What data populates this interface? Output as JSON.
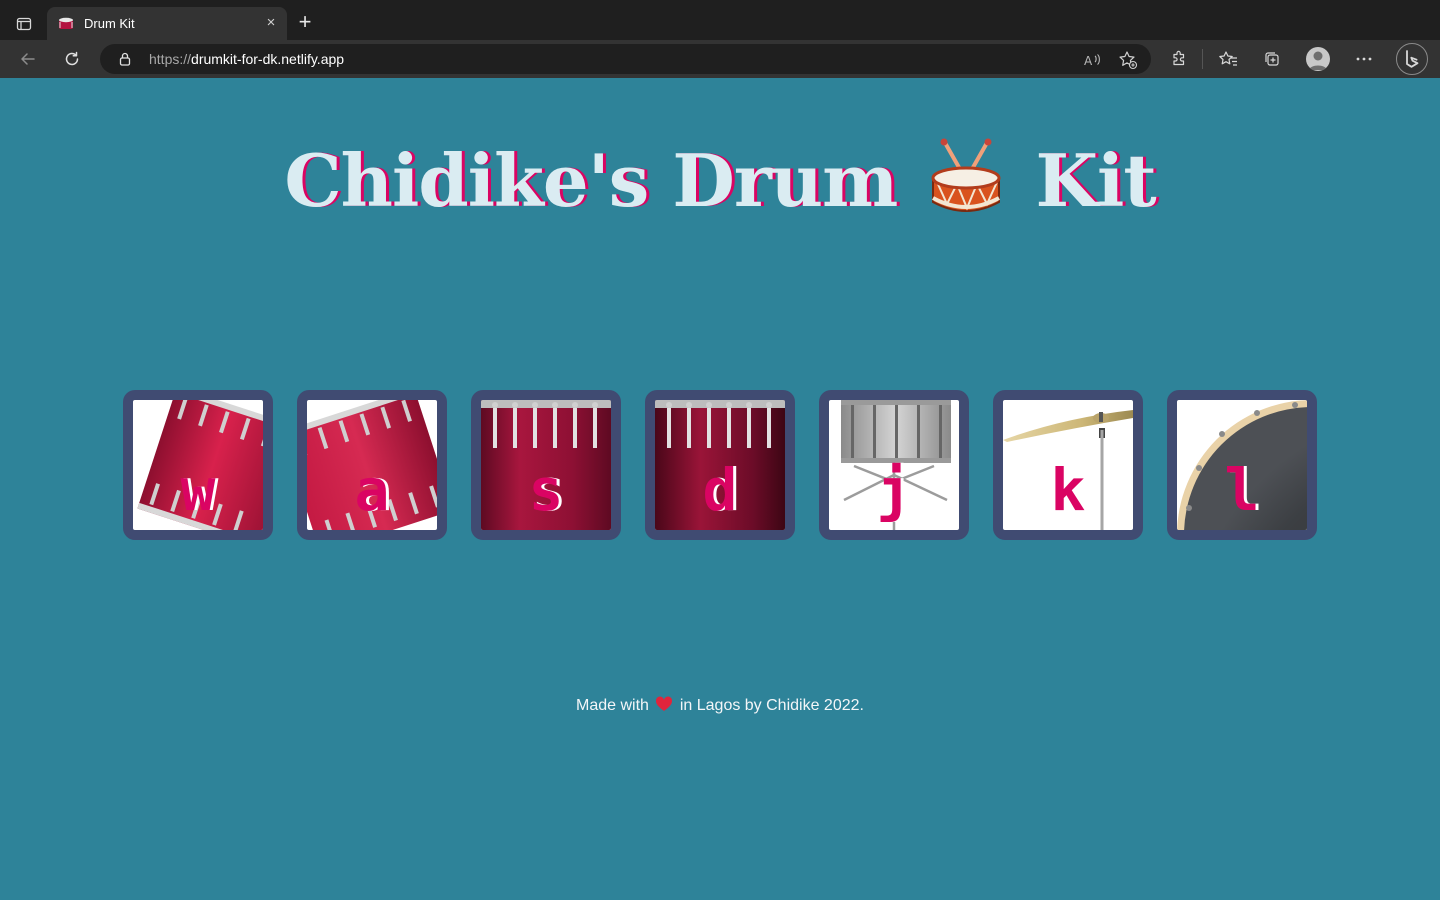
{
  "browser": {
    "tab_title": "Drum Kit",
    "tab_close": "×",
    "new_tab": "+",
    "url_protocol": "https://",
    "url_host": "drumkit-for-dk.netlify.app"
  },
  "page": {
    "title_part1": "Chidike's Drum",
    "title_part2": "Kit"
  },
  "drums": [
    {
      "key": "w",
      "art": "tom-tilted-left-icon"
    },
    {
      "key": "a",
      "art": "tom-tilted-right-icon"
    },
    {
      "key": "s",
      "art": "snare-icon"
    },
    {
      "key": "d",
      "art": "snare-dark-icon"
    },
    {
      "key": "j",
      "art": "silver-snare-icon"
    },
    {
      "key": "k",
      "art": "crash-cymbal-icon"
    },
    {
      "key": "l",
      "art": "kick-drum-icon"
    }
  ],
  "footer": {
    "before": "Made with",
    "after": "in Lagos by Chidike 2022."
  },
  "colors": {
    "background": "#2e8399",
    "drum_border": "#404b72",
    "accent": "#da0463",
    "title_text": "#daecf2"
  }
}
